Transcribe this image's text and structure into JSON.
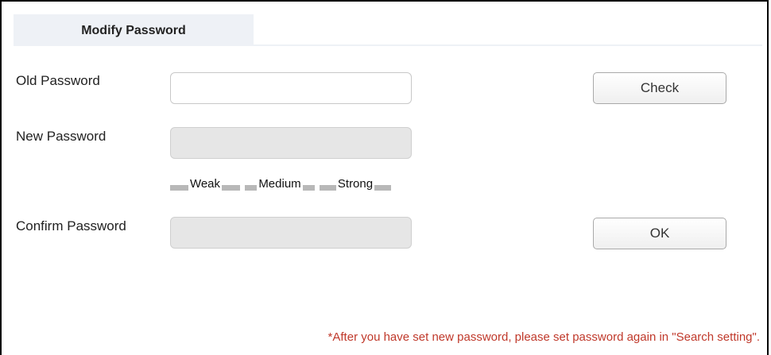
{
  "tab": {
    "label": "Modify Password"
  },
  "form": {
    "old_password": {
      "label": "Old Password",
      "value": ""
    },
    "new_password": {
      "label": "New Password",
      "value": ""
    },
    "confirm_password": {
      "label": "Confirm Password",
      "value": ""
    },
    "strength": {
      "weak": "Weak",
      "medium": "Medium",
      "strong": "Strong"
    }
  },
  "buttons": {
    "check": "Check",
    "ok": "OK"
  },
  "note": "*After you have set new password, please set password again in \"Search setting\".",
  "colors": {
    "note_text": "#c0392b",
    "tab_background": "#eef1f6",
    "disabled_field": "#e6e6e6",
    "strength_bar": "#b8b8b8"
  }
}
